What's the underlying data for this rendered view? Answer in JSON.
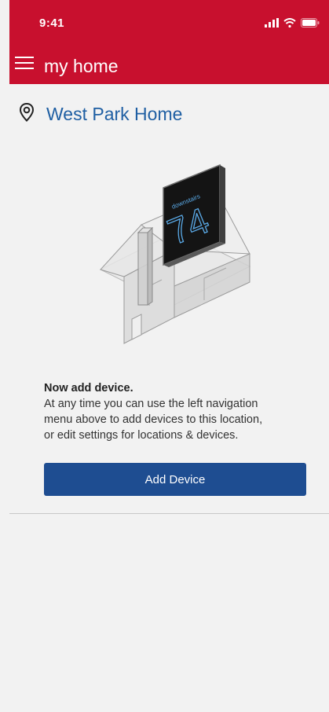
{
  "status_bar": {
    "time": "9:41",
    "icons": [
      "signal-icon",
      "wifi-icon",
      "battery-icon"
    ]
  },
  "app_bar": {
    "title": "my home",
    "menu_icon": "hamburger-menu-icon"
  },
  "location": {
    "icon": "location-pin-icon",
    "name": "West Park Home"
  },
  "illustration": {
    "thermostat_label": "downstairs",
    "thermostat_temperature": "74"
  },
  "message": {
    "title": "Now add device.",
    "body_lines": [
      "At any time you can use the left navigation",
      "menu above to add devices to this location,",
      "or edit  settings for locations & devices."
    ]
  },
  "actions": {
    "add_device_label": "Add Device"
  },
  "colors": {
    "header_red": "#c8102e",
    "location_blue": "#1f5fa3",
    "button_blue": "#1e4d91",
    "background": "#f2f2f2"
  }
}
